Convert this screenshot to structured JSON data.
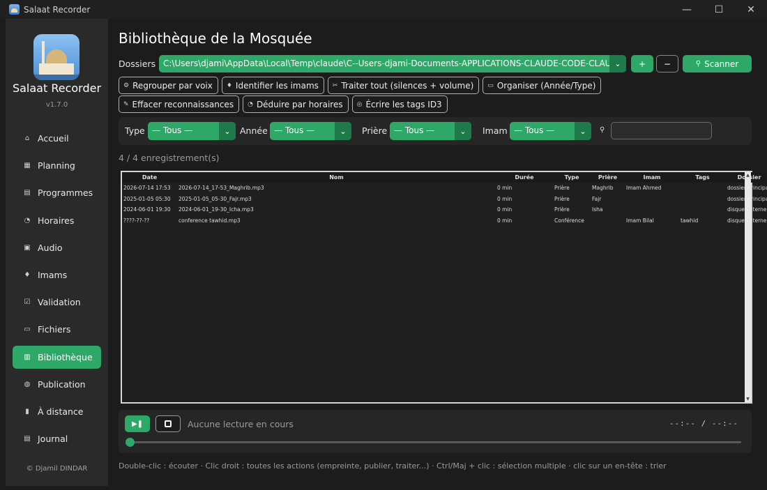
{
  "window": {
    "title": "Salaat Recorder",
    "controls": {
      "minimize": "—",
      "maximize": "☐",
      "close": "✕"
    }
  },
  "sidebar": {
    "app_name": "Salaat Recorder",
    "version": "v1.7.0",
    "items": [
      {
        "label": "Accueil",
        "icon": "home-icon",
        "glyph": "⌂"
      },
      {
        "label": "Planning",
        "icon": "calendar-icon",
        "glyph": "▦"
      },
      {
        "label": "Programmes",
        "icon": "programs-icon",
        "glyph": "▤"
      },
      {
        "label": "Horaires",
        "icon": "clock-icon",
        "glyph": "◔"
      },
      {
        "label": "Audio",
        "icon": "audio-icon",
        "glyph": "▣"
      },
      {
        "label": "Imams",
        "icon": "microphone-icon",
        "glyph": "♦"
      },
      {
        "label": "Validation",
        "icon": "checkbox-icon",
        "glyph": "☑"
      },
      {
        "label": "Fichiers",
        "icon": "folder-icon",
        "glyph": "▭"
      },
      {
        "label": "Bibliothèque",
        "icon": "library-icon",
        "glyph": "▥"
      },
      {
        "label": "Publication",
        "icon": "globe-icon",
        "glyph": "◍"
      },
      {
        "label": "À distance",
        "icon": "remote-icon",
        "glyph": "▮"
      },
      {
        "label": "Journal",
        "icon": "journal-icon",
        "glyph": "▤"
      }
    ],
    "active": "Bibliothèque",
    "copyright": "© Djamil DINDAR"
  },
  "main": {
    "title": "Bibliothèque de la Mosquée",
    "dossiers": {
      "label": "Dossiers :",
      "value": "C:\\Users\\djami\\AppData\\Local\\Temp\\claude\\C--Users-djami-Documents-APPLICATIONS-CLAUDE-CODE-CLAUDE-COD",
      "add_label": "+",
      "remove_label": "−",
      "scan_label": "Scanner"
    },
    "actions_row1": [
      {
        "label": "Regrouper par voix",
        "icon": "group-icon",
        "glyph": "⚙"
      },
      {
        "label": "Identifier les imams",
        "icon": "microphone-icon",
        "glyph": "♦"
      },
      {
        "label": "Traiter tout (silences + volume)",
        "icon": "tools-icon",
        "glyph": "✂"
      },
      {
        "label": "Organiser (Année/Type)",
        "icon": "folder-icon",
        "glyph": "▭"
      }
    ],
    "actions_row2": [
      {
        "label": "Effacer reconnaissances",
        "icon": "eraser-icon",
        "glyph": "✎"
      },
      {
        "label": "Déduire par horaires",
        "icon": "clock-icon",
        "glyph": "◔"
      },
      {
        "label": "Écrire les tags ID3",
        "icon": "tag-icon",
        "glyph": "◎"
      }
    ],
    "filters": {
      "type_label": "Type :",
      "type_value": "— Tous —",
      "year_label": "Année :",
      "year_value": "— Tous —",
      "prayer_label": "Prière :",
      "prayer_value": "— Tous —",
      "imam_label": "Imam :",
      "imam_value": "— Tous —",
      "search_value": ""
    },
    "count": "4 / 4 enregistrement(s)",
    "table": {
      "columns": [
        "Date",
        "Nom",
        "Durée",
        "Type",
        "Prière",
        "Imam",
        "Tags",
        "Dossier"
      ],
      "rows": [
        [
          "2026-07-14 17:53",
          "2026-07-14_17-53_Maghrib.mp3",
          "0 min",
          "Prière",
          "Maghrib",
          "Imam Ahmed",
          "",
          "dossier-principal"
        ],
        [
          "2025-01-05 05:30",
          "2025-01-05_05-30_Fajr.mp3",
          "0 min",
          "Prière",
          "Fajr",
          "",
          "",
          "dossier-principal"
        ],
        [
          "2024-06-01 19:30",
          "2024-06-01_19-30_Icha.mp3",
          "0 min",
          "Prière",
          "Isha",
          "",
          "",
          "disque-externe"
        ],
        [
          "????-??-??",
          "conference tawhid.mp3",
          "0 min",
          "Conférence",
          "",
          "Imam Bilal",
          "tawhid",
          "disque-externe"
        ]
      ]
    },
    "player": {
      "status": "Aucune lecture en cours",
      "time": "--:-- / --:--",
      "progress": 0
    },
    "hint": "Double-clic : écouter · Clic droit : toutes les actions (empreinte, publier, traiter...) · Ctrl/Maj + clic : sélection multiple · clic sur un en-tête : trier"
  },
  "colors": {
    "accent": "#2ea866",
    "accent_dark": "#1f7a49",
    "background": "#1c1c1c",
    "panel": "#262626"
  }
}
